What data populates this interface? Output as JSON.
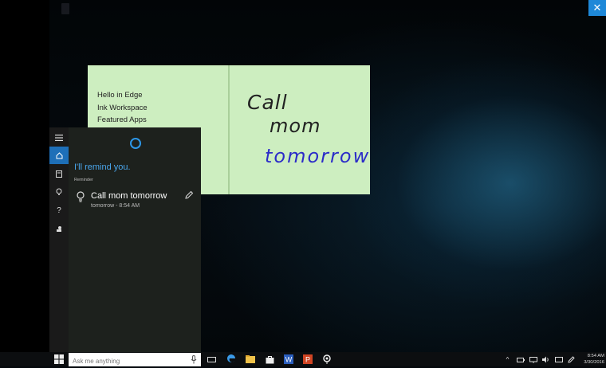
{
  "sticky_note": {
    "typed_lines": [
      "Hello in Edge",
      "Ink Workspace",
      "Featured Apps"
    ],
    "handwriting": [
      "Call",
      "mom",
      "tomorrow"
    ]
  },
  "cortana": {
    "heading": "I'll remind you.",
    "label": "Reminder",
    "reminder_title": "Call mom tomorrow",
    "reminder_time": "tomorrow - 8:54 AM",
    "nav_icons": [
      "menu-icon",
      "home-icon",
      "notebook-icon",
      "lightbulb-icon",
      "help-icon",
      "feedback-icon"
    ]
  },
  "taskbar": {
    "search_placeholder": "Ask me anything",
    "time": "8:54 AM",
    "date": "3/30/2016"
  },
  "window": {
    "close_label": "✕"
  },
  "colors": {
    "accent": "#1e88d8",
    "sticky": "#cdeec0",
    "ink_blue": "#2c2cc8"
  }
}
